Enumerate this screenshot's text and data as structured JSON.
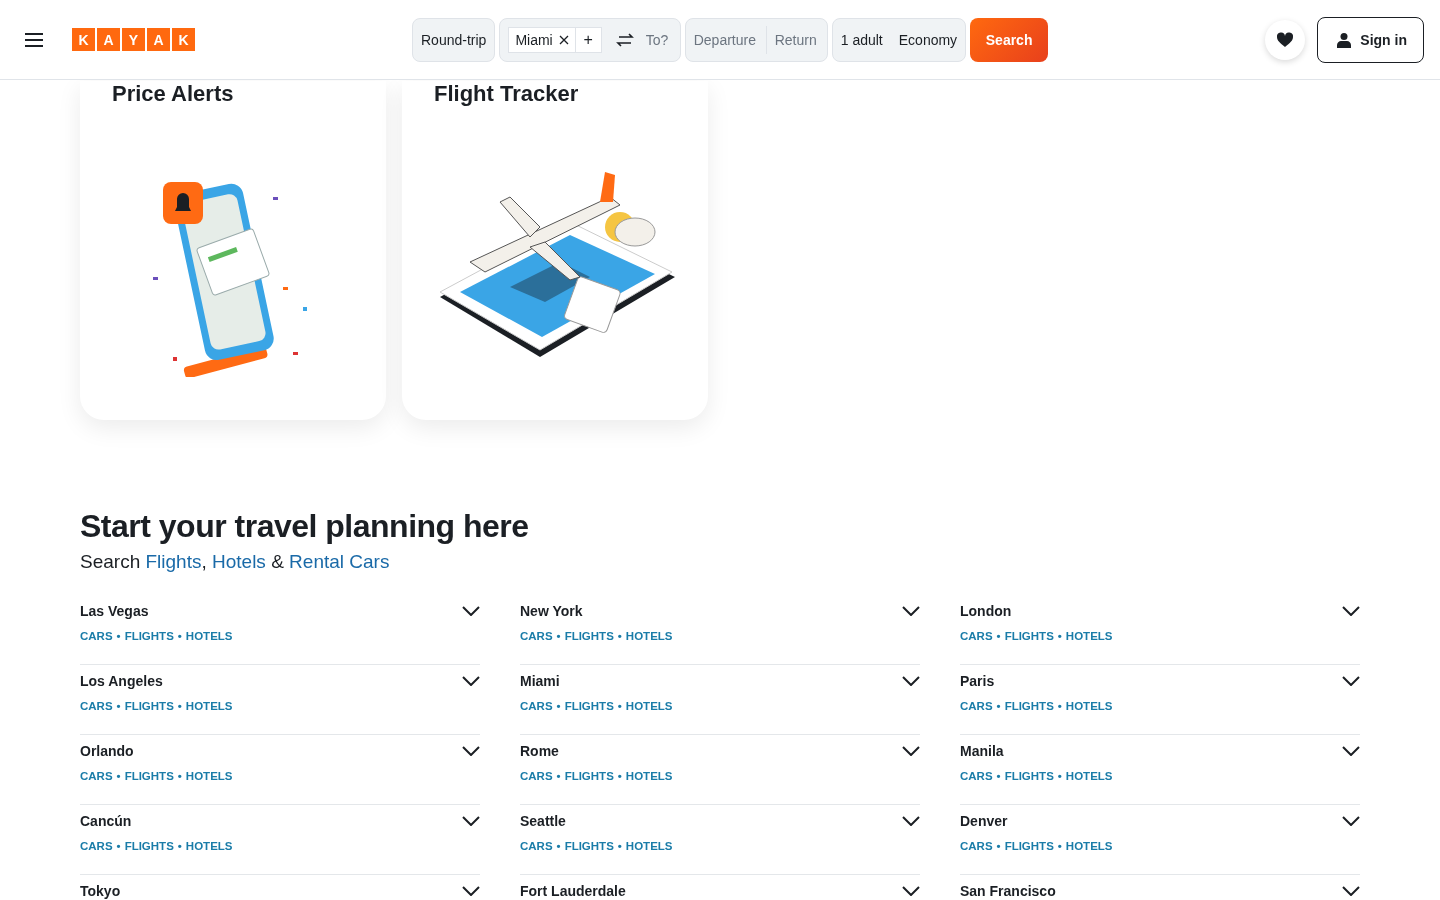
{
  "header": {
    "logo_letters": [
      "K",
      "A",
      "Y",
      "A",
      "K"
    ],
    "trip_type": "Round-trip",
    "origin": "Miami",
    "add_origin": "+",
    "destination_placeholder": "To?",
    "departure_placeholder": "Departure",
    "return_placeholder": "Return",
    "travelers": "1 adult",
    "cabin": "Economy",
    "search_button": "Search",
    "sign_in": "Sign in"
  },
  "cards": [
    {
      "title": "Price Alerts",
      "kind": "alerts"
    },
    {
      "title": "Flight Tracker",
      "kind": "tracker"
    }
  ],
  "planning": {
    "title": "Start your travel planning here",
    "subtitle": [
      {
        "text": "Search "
      },
      {
        "link": "Flights"
      },
      {
        "text": ", "
      },
      {
        "link": "Hotels"
      },
      {
        "text": " & "
      },
      {
        "link": "Rental Cars"
      }
    ],
    "link_separator": "•",
    "columns": [
      [
        {
          "city": "Las Vegas",
          "links": [
            "CARS",
            "FLIGHTS",
            "HOTELS"
          ]
        },
        {
          "city": "Los Angeles",
          "links": [
            "CARS",
            "FLIGHTS",
            "HOTELS"
          ]
        },
        {
          "city": "Orlando",
          "links": [
            "CARS",
            "FLIGHTS",
            "HOTELS"
          ]
        },
        {
          "city": "Cancún",
          "links": [
            "CARS",
            "FLIGHTS",
            "HOTELS"
          ]
        },
        {
          "city": "Tokyo"
        }
      ],
      [
        {
          "city": "New York",
          "links": [
            "CARS",
            "FLIGHTS",
            "HOTELS"
          ]
        },
        {
          "city": "Miami",
          "links": [
            "CARS",
            "FLIGHTS",
            "HOTELS"
          ]
        },
        {
          "city": "Rome",
          "links": [
            "CARS",
            "FLIGHTS",
            "HOTELS"
          ]
        },
        {
          "city": "Seattle",
          "links": [
            "CARS",
            "FLIGHTS",
            "HOTELS"
          ]
        },
        {
          "city": "Fort Lauderdale"
        }
      ],
      [
        {
          "city": "London",
          "links": [
            "CARS",
            "FLIGHTS",
            "HOTELS"
          ]
        },
        {
          "city": "Paris",
          "links": [
            "CARS",
            "FLIGHTS",
            "HOTELS"
          ]
        },
        {
          "city": "Manila",
          "links": [
            "CARS",
            "FLIGHTS",
            "HOTELS"
          ]
        },
        {
          "city": "Denver",
          "links": [
            "CARS",
            "FLIGHTS",
            "HOTELS"
          ]
        },
        {
          "city": "San Francisco"
        }
      ]
    ]
  }
}
